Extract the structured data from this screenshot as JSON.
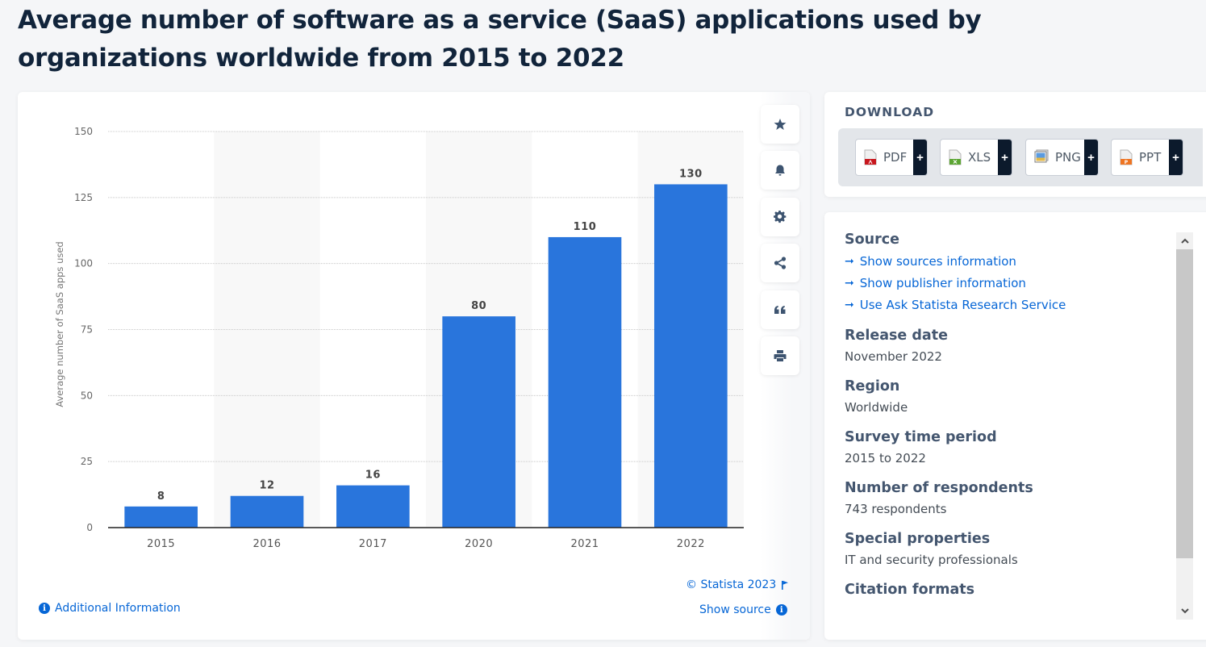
{
  "page": {
    "title": "Average number of software as a service (SaaS) applications used by organizations worldwide from 2015 to 2022"
  },
  "chart_data": {
    "type": "bar",
    "title": "Average number of software as a service (SaaS) applications used by organizations worldwide from 2015 to 2022",
    "categories": [
      "2015",
      "2016",
      "2017",
      "2020",
      "2021",
      "2022"
    ],
    "values": [
      8,
      12,
      16,
      80,
      110,
      130
    ],
    "data_labels": [
      "8",
      "12",
      "16",
      "80",
      "110",
      "130"
    ],
    "xlabel": "",
    "ylabel": "Average number of SaaS apps used",
    "ylim": [
      0,
      150
    ],
    "yticks": [
      0,
      25,
      50,
      75,
      100,
      125,
      150
    ],
    "grid": true,
    "legend": "none",
    "bar_color": "#2975dc",
    "band_color": "#f8f8f8"
  },
  "chart_footer": {
    "copyright": "© Statista 2023",
    "additional_info": "Additional Information",
    "show_source": "Show source"
  },
  "tools": [
    {
      "name": "favorite",
      "icon": "star-icon"
    },
    {
      "name": "notification",
      "icon": "bell-icon"
    },
    {
      "name": "settings",
      "icon": "gear-icon"
    },
    {
      "name": "share",
      "icon": "share-icon"
    },
    {
      "name": "cite",
      "icon": "quote-icon"
    },
    {
      "name": "print",
      "icon": "print-icon"
    }
  ],
  "download": {
    "heading": "DOWNLOAD",
    "buttons": [
      {
        "label": "PDF",
        "icon": "pdf-file-icon",
        "color": "#c8171e"
      },
      {
        "label": "XLS",
        "icon": "xls-file-icon",
        "color": "#5ba532"
      },
      {
        "label": "PNG",
        "icon": "png-image-icon",
        "color": "#3a7fd4"
      },
      {
        "label": "PPT",
        "icon": "ppt-file-icon",
        "color": "#ee7422"
      }
    ],
    "plus_label": "+"
  },
  "info": {
    "source": {
      "heading": "Source",
      "links": [
        "Show sources information",
        "Show publisher information",
        "Use Ask Statista Research Service"
      ]
    },
    "sections": [
      {
        "heading": "Release date",
        "value": "November 2022"
      },
      {
        "heading": "Region",
        "value": "Worldwide"
      },
      {
        "heading": "Survey time period",
        "value": "2015 to 2022"
      },
      {
        "heading": "Number of respondents",
        "value": "743 respondents"
      },
      {
        "heading": "Special properties",
        "value": "IT and security professionals"
      },
      {
        "heading": "Citation formats",
        "value": ""
      }
    ]
  },
  "colors": {
    "accent": "#0666d6",
    "heading": "#44566f",
    "title": "#11243b"
  }
}
